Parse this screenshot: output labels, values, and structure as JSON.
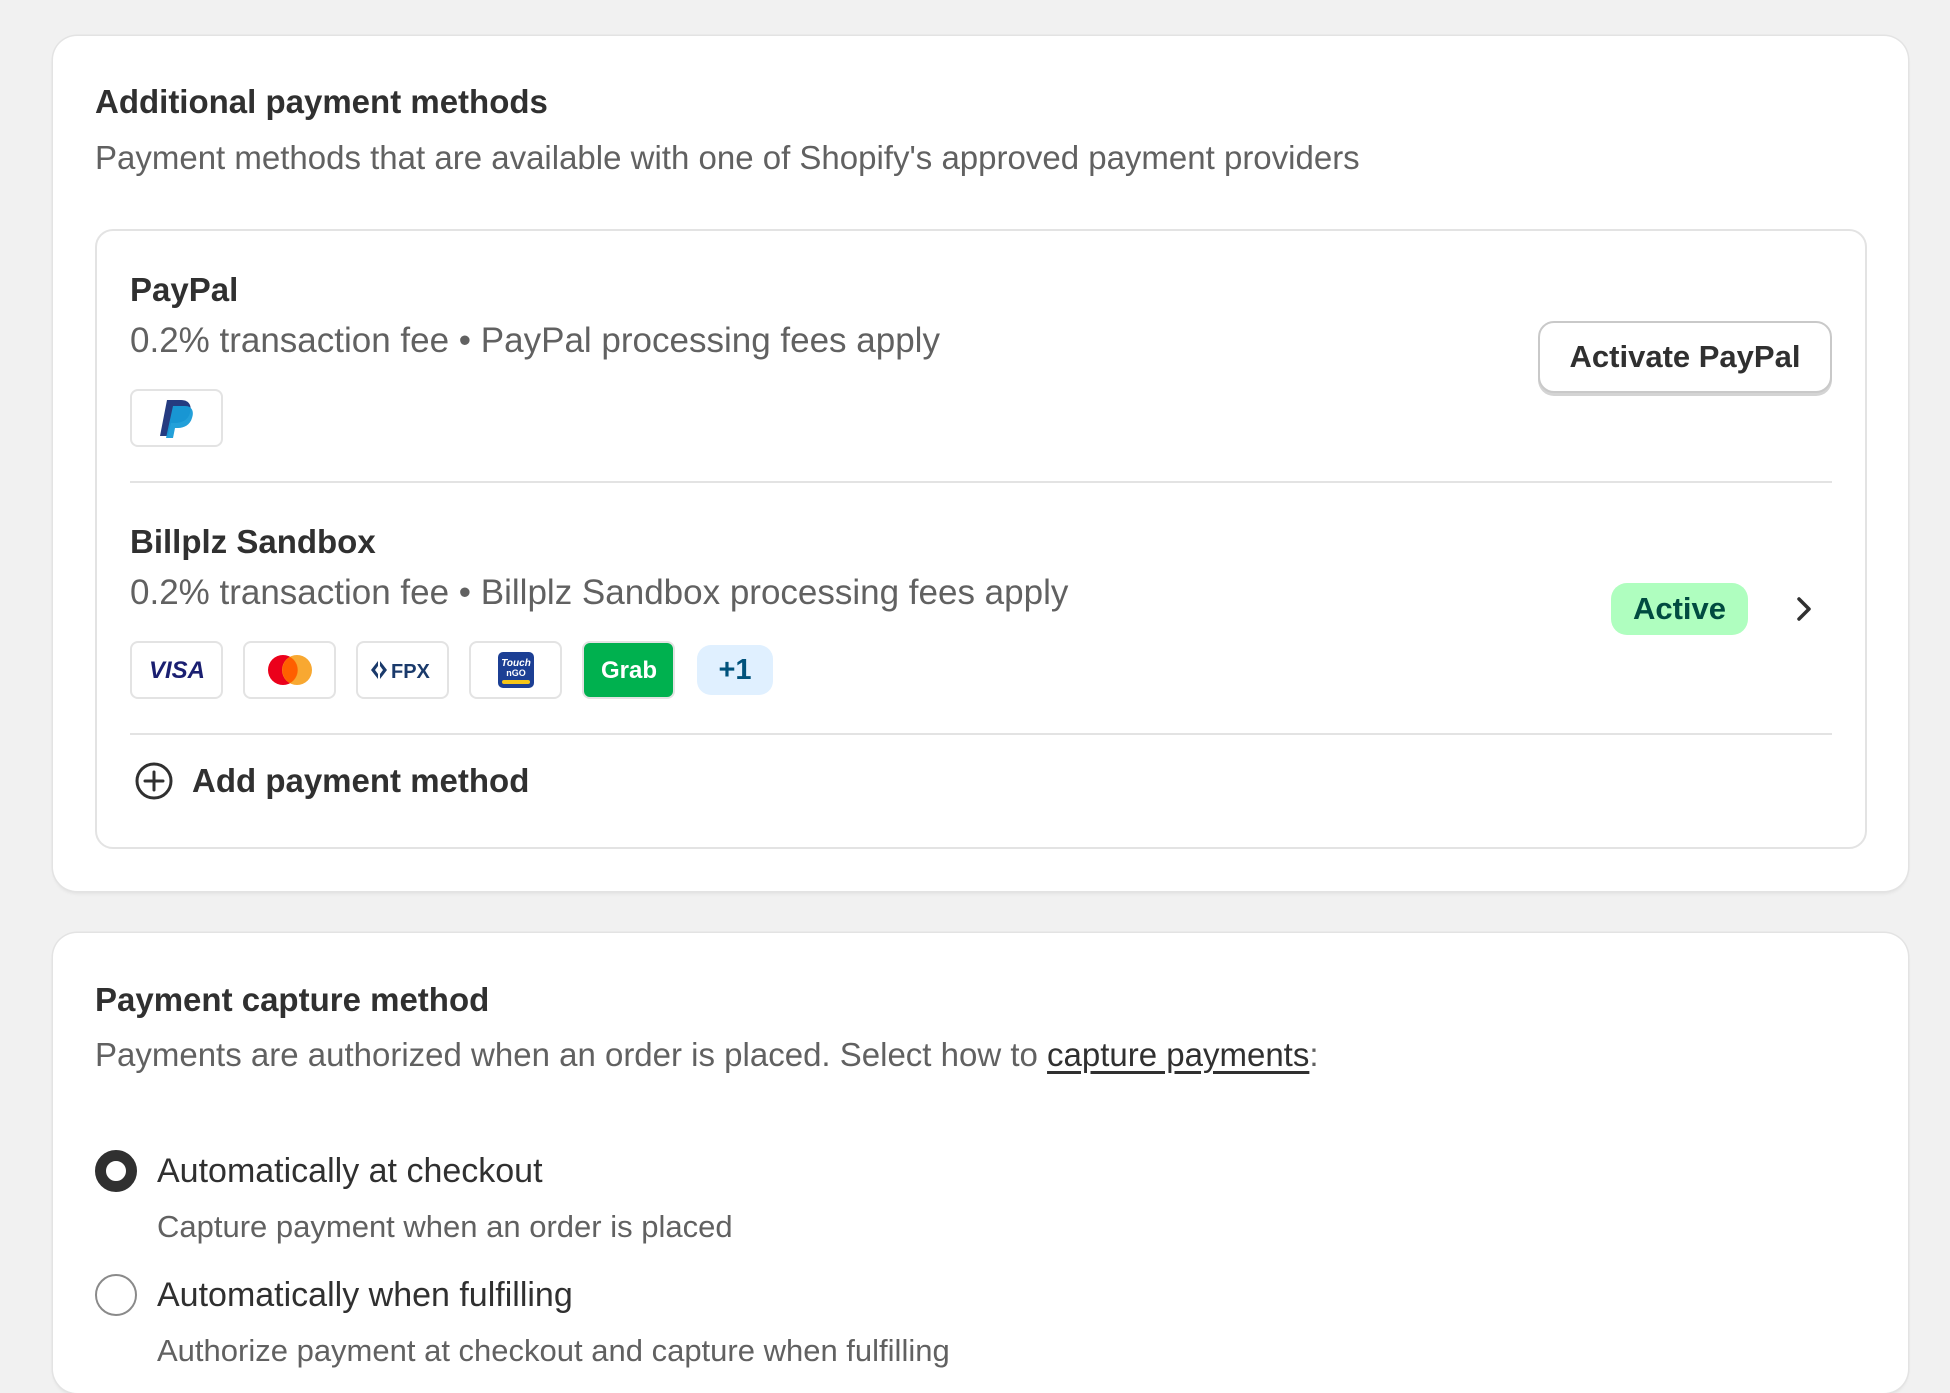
{
  "additional_methods": {
    "title": "Additional payment methods",
    "subtitle": "Payment methods that are available with one of Shopify's approved payment providers",
    "providers": [
      {
        "name": "PayPal",
        "fee_text": "0.2% transaction fee • PayPal processing fees apply",
        "action_label": "Activate PayPal",
        "icons": [
          "paypal-icon"
        ]
      },
      {
        "name": "Billplz Sandbox",
        "fee_text": "0.2% transaction fee • Billplz Sandbox processing fees apply",
        "status": "Active",
        "icons": [
          "visa-icon",
          "mastercard-icon",
          "fpx-icon",
          "touch-n-go-icon",
          "grab-icon"
        ],
        "more_label": "+1"
      }
    ],
    "add_label": "Add payment method"
  },
  "capture_method": {
    "title": "Payment capture method",
    "subtitle_prefix": "Payments are authorized when an order is placed. Select how to ",
    "subtitle_link": "capture payments",
    "subtitle_suffix": ":",
    "options": [
      {
        "label": "Automatically at checkout",
        "help": "Capture payment when an order is placed",
        "selected": true
      },
      {
        "label": "Automatically when fulfilling",
        "help": "Authorize payment at checkout and capture when fulfilling",
        "selected": false
      }
    ]
  },
  "colors": {
    "page_bg": "#f1f1f1",
    "card_bg": "#ffffff",
    "text_primary": "#303030",
    "text_secondary": "#616161",
    "badge_success_bg": "#affebf",
    "badge_success_text": "#014b40",
    "more_badge_bg": "#e0f0ff",
    "paypal_dark": "#253b80",
    "paypal_light": "#179bd7",
    "visa_blue": "#1a1f71",
    "mastercard_red": "#eb001b",
    "mastercard_orange": "#f79e1b",
    "grab_green": "#00b14f"
  }
}
